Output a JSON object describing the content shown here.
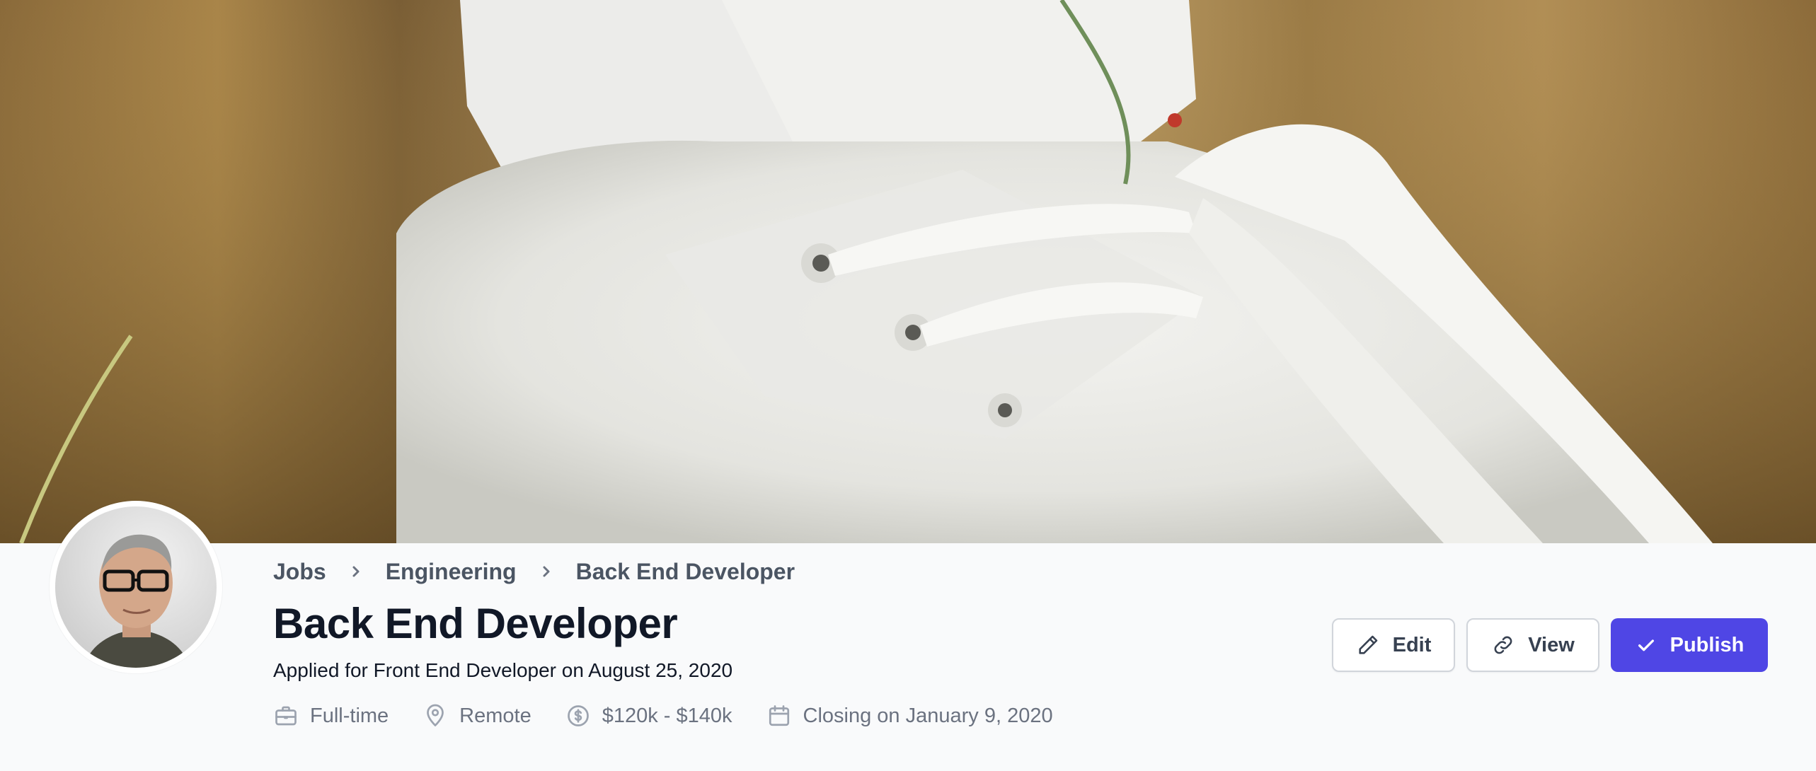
{
  "cover": {
    "image": "white-sneaker-in-grass-photo"
  },
  "avatar": {
    "image": "man-with-glasses-portrait"
  },
  "breadcrumb": {
    "items": [
      "Jobs",
      "Engineering",
      "Back End Developer"
    ]
  },
  "job": {
    "title": "Back End Developer",
    "subtitle": "Applied for Front End Developer on August 25, 2020"
  },
  "meta": {
    "type": "Full-time",
    "location": "Remote",
    "salary": "$120k - $140k",
    "closing": "Closing on January 9, 2020"
  },
  "actions": {
    "edit": "Edit",
    "view": "View",
    "publish": "Publish"
  },
  "colors": {
    "accent": "#4f46e5",
    "text": "#111827",
    "muted": "#6b7280",
    "background": "#f9fafb"
  }
}
